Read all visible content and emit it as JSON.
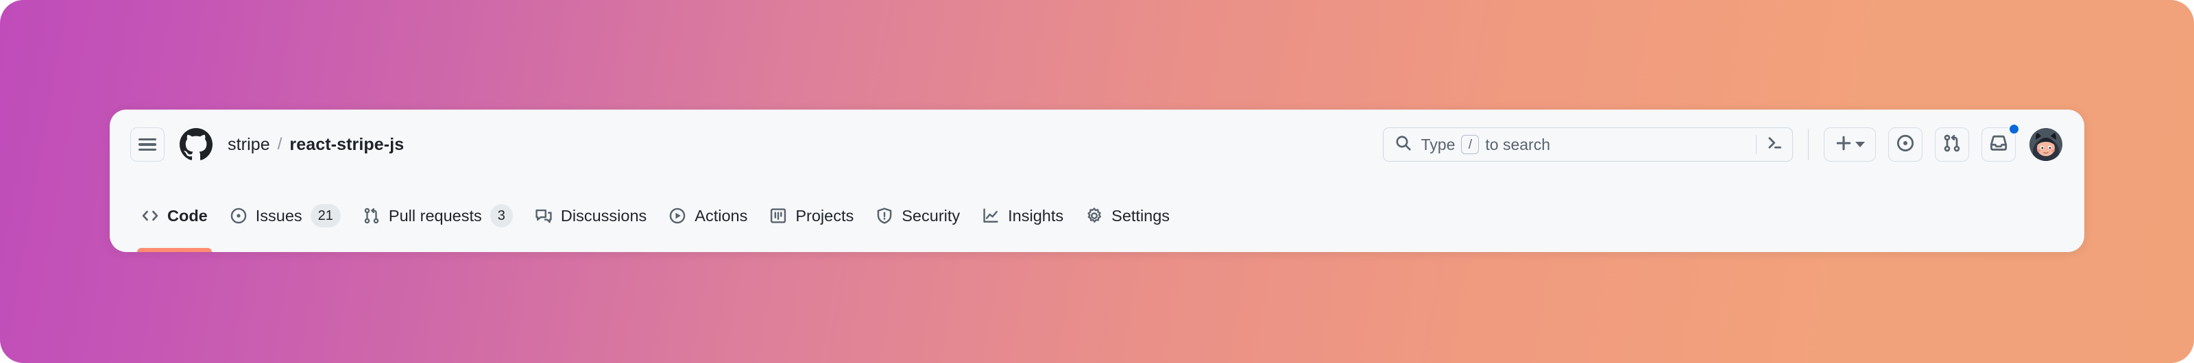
{
  "theme": {
    "gradient_start": "#bf4cba",
    "gradient_end": "#f1a279",
    "card_bg": "#f6f8fa",
    "accent_underline": "#fd8c73",
    "unread_dot": "#0969da",
    "text_primary": "#1f2328",
    "text_muted": "#59636e"
  },
  "header": {
    "menu_button": {
      "icon": "hamburger-icon"
    },
    "logo": {
      "icon": "github-logo-icon"
    },
    "breadcrumb": {
      "owner": "stripe",
      "separator": "/",
      "repo": "react-stripe-js"
    }
  },
  "search": {
    "icon": "search-icon",
    "placeholder_prefix": "Type",
    "key_hint": "/",
    "placeholder_suffix": "to search",
    "command_palette_icon": "terminal-icon"
  },
  "actions": [
    {
      "name": "create-new-button",
      "icon": "plus-icon",
      "has_caret": true
    },
    {
      "name": "issues-button",
      "icon": "issue-opened-icon"
    },
    {
      "name": "pull-requests-button",
      "icon": "git-pull-request-icon"
    },
    {
      "name": "notifications-button",
      "icon": "inbox-icon",
      "unread": true
    },
    {
      "name": "user-avatar",
      "icon": "avatar-octocat"
    }
  ],
  "tabs": [
    {
      "label": "Code",
      "icon": "code-icon",
      "count": null,
      "active": true
    },
    {
      "label": "Issues",
      "icon": "issue-opened-icon",
      "count": "21",
      "active": false
    },
    {
      "label": "Pull requests",
      "icon": "git-pull-request-icon",
      "count": "3",
      "active": false
    },
    {
      "label": "Discussions",
      "icon": "comment-discussion-icon",
      "count": null,
      "active": false
    },
    {
      "label": "Actions",
      "icon": "play-icon",
      "count": null,
      "active": false
    },
    {
      "label": "Projects",
      "icon": "project-board-icon",
      "count": null,
      "active": false
    },
    {
      "label": "Security",
      "icon": "shield-alert-icon",
      "count": null,
      "active": false
    },
    {
      "label": "Insights",
      "icon": "graph-icon",
      "count": null,
      "active": false
    },
    {
      "label": "Settings",
      "icon": "gear-icon",
      "count": null,
      "active": false
    }
  ]
}
